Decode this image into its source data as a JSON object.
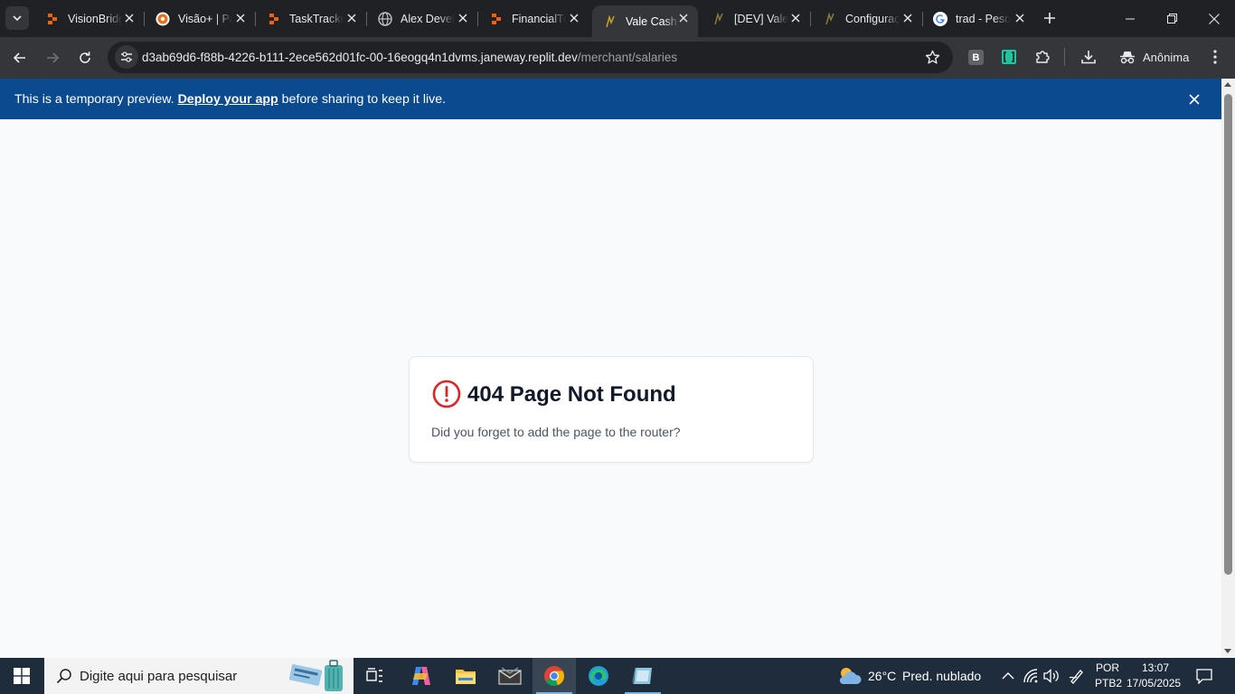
{
  "browser": {
    "tabs": [
      {
        "title": "VisionBridge",
        "favicon": "replit-icon",
        "active": false
      },
      {
        "title": "Visão+ | Painel",
        "favicon": "visao-icon",
        "active": false
      },
      {
        "title": "TaskTracker",
        "favicon": "replit-icon",
        "active": false
      },
      {
        "title": "Alex Developer",
        "favicon": "globe-icon",
        "active": false
      },
      {
        "title": "FinancialTrack",
        "favicon": "replit-icon",
        "active": false
      },
      {
        "title": "Vale Cash",
        "favicon": "pulse-icon",
        "active": true
      },
      {
        "title": "[DEV] Vale Cash",
        "favicon": "pulse-icon",
        "active": false
      },
      {
        "title": "Configurações",
        "favicon": "pulse-icon",
        "active": false
      },
      {
        "title": "trad - Pesquisa Google",
        "favicon": "google-icon",
        "active": false
      }
    ],
    "url_host": "d3ab69d6-f88b-4226-b111-2ece562d01fc-00-16eogq4n1dvms.janeway.replit.dev",
    "url_path": "/merchant/salaries",
    "extension_b_label": "B",
    "profile_label": "Anônima"
  },
  "banner": {
    "text_before": "This is a temporary preview. ",
    "link_text": "Deploy your app",
    "text_after": " before sharing to keep it live."
  },
  "page": {
    "title": "404 Page Not Found",
    "message": "Did you forget to add the page to the router?",
    "accent_color": "#dc2626"
  },
  "taskbar": {
    "search_placeholder": "Digite aqui para pesquisar",
    "weather_temp": "26°C",
    "weather_desc": "Pred. nublado",
    "language": "POR",
    "keyboard": "PTB2",
    "time": "13:07",
    "date": "17/05/2025"
  }
}
